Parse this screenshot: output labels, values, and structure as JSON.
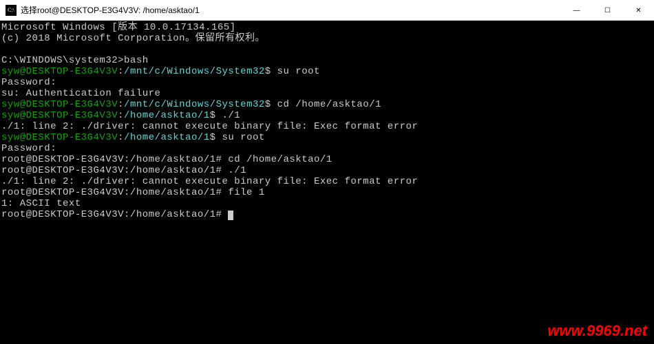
{
  "titlebar": {
    "icon_text": "C:\\",
    "title": "选择root@DESKTOP-E3G4V3V: /home/asktao/1"
  },
  "window_controls": {
    "minimize": "—",
    "maximize": "☐",
    "close": "✕"
  },
  "lines": [
    [
      {
        "cls": "white",
        "text": "Microsoft Windows [版本 10.0.17134.165]"
      }
    ],
    [
      {
        "cls": "white",
        "text": "(c) 2018 Microsoft Corporation。保留所有权利。"
      }
    ],
    [
      {
        "cls": "white",
        "text": ""
      }
    ],
    [
      {
        "cls": "white",
        "text": "C:\\WINDOWS\\system32>bash"
      }
    ],
    [
      {
        "cls": "green",
        "text": "syw@DESKTOP-E3G4V3V"
      },
      {
        "cls": "white",
        "text": ":"
      },
      {
        "cls": "cyan",
        "text": "/mnt/c/Windows/System32"
      },
      {
        "cls": "white",
        "text": "$ su root"
      }
    ],
    [
      {
        "cls": "white",
        "text": "Password:"
      }
    ],
    [
      {
        "cls": "white",
        "text": "su: Authentication failure"
      }
    ],
    [
      {
        "cls": "green",
        "text": "syw@DESKTOP-E3G4V3V"
      },
      {
        "cls": "white",
        "text": ":"
      },
      {
        "cls": "cyan",
        "text": "/mnt/c/Windows/System32"
      },
      {
        "cls": "white",
        "text": "$ cd /home/asktao/1"
      }
    ],
    [
      {
        "cls": "green",
        "text": "syw@DESKTOP-E3G4V3V"
      },
      {
        "cls": "white",
        "text": ":"
      },
      {
        "cls": "cyan",
        "text": "/home/asktao/1"
      },
      {
        "cls": "white",
        "text": "$ ./1"
      }
    ],
    [
      {
        "cls": "white",
        "text": "./1: line 2: ./driver: cannot execute binary file: Exec format error"
      }
    ],
    [
      {
        "cls": "green",
        "text": "syw@DESKTOP-E3G4V3V"
      },
      {
        "cls": "white",
        "text": ":"
      },
      {
        "cls": "cyan",
        "text": "/home/asktao/1"
      },
      {
        "cls": "white",
        "text": "$ su root"
      }
    ],
    [
      {
        "cls": "white",
        "text": "Password:"
      }
    ],
    [
      {
        "cls": "white",
        "text": "root@DESKTOP-E3G4V3V:/home/asktao/1# cd /home/asktao/1"
      }
    ],
    [
      {
        "cls": "white",
        "text": "root@DESKTOP-E3G4V3V:/home/asktao/1# ./1"
      }
    ],
    [
      {
        "cls": "white",
        "text": "./1: line 2: ./driver: cannot execute binary file: Exec format error"
      }
    ],
    [
      {
        "cls": "white",
        "text": "root@DESKTOP-E3G4V3V:/home/asktao/1# file 1"
      }
    ],
    [
      {
        "cls": "white",
        "text": "1: ASCII text"
      }
    ],
    [
      {
        "cls": "white",
        "text": "root@DESKTOP-E3G4V3V:/home/asktao/1# "
      },
      {
        "cursor": true
      }
    ]
  ],
  "watermark": "www.9969.net"
}
